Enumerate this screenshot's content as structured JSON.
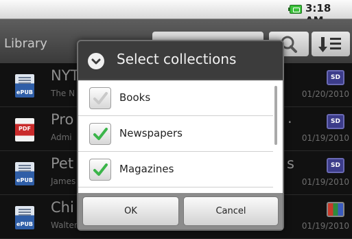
{
  "status_bar": {
    "time": "3:18 AM",
    "battery_icon": "battery-charging-icon"
  },
  "app": {
    "title": "Library",
    "search_icon": "search-icon",
    "sort_icon": "sort-icon"
  },
  "list": [
    {
      "icon": "epub-icon",
      "icon_text": "ePUB",
      "title": "NYT",
      "subtitle": "The N",
      "badge": "SD",
      "date": "01/20/2010"
    },
    {
      "icon": "pdf-icon",
      "icon_text": "PDF",
      "title": "Pro",
      "subtitle": "Admi",
      "badge": "SD",
      "date": "01/19/2010",
      "overflow": "."
    },
    {
      "icon": "epub-icon",
      "icon_text": "ePUB",
      "title": "Pet",
      "subtitle": "James",
      "badge": "SD",
      "date": "01/19/2010",
      "overflow": "s"
    },
    {
      "icon": "epub-icon",
      "icon_text": "ePUB",
      "title": "Chi",
      "subtitle": "Walter Henry Medhurst",
      "badge": "",
      "badge_icon": "books-icon",
      "date": "01/19/2010"
    }
  ],
  "dialog": {
    "icon": "chevron-down-circle-icon",
    "title": "Select collections",
    "options": [
      {
        "label": "Books",
        "checked": false
      },
      {
        "label": "Newspapers",
        "checked": true
      },
      {
        "label": "Magazines",
        "checked": true
      }
    ],
    "ok_label": "OK",
    "cancel_label": "Cancel"
  },
  "colors": {
    "check_green": "#3bb54a",
    "dialog_bg": "#3c3c3c"
  }
}
